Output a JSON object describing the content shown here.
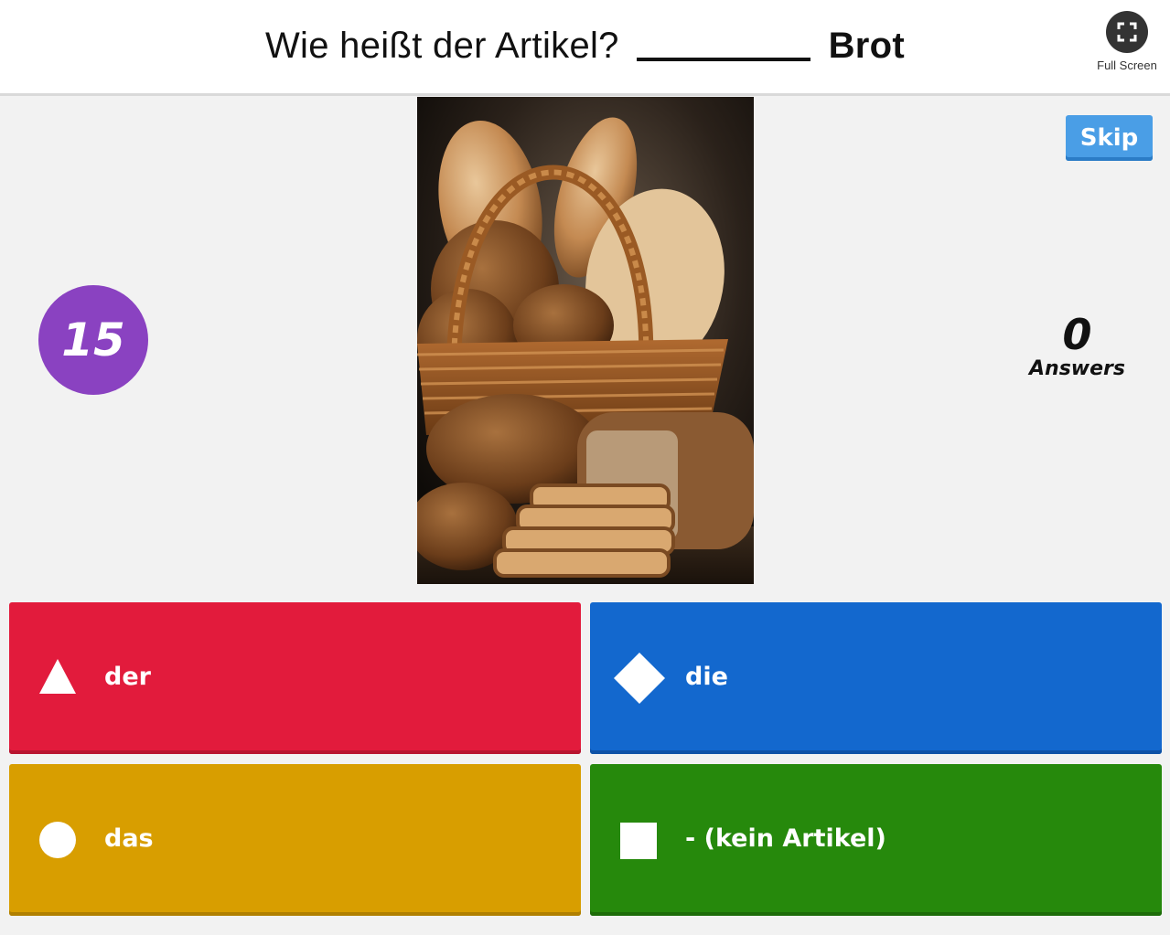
{
  "header": {
    "question": "Wie heißt der Artikel?",
    "word": "Brot",
    "fullscreen_label": "Full Screen"
  },
  "controls": {
    "skip_label": "Skip"
  },
  "timer": {
    "seconds": "15"
  },
  "answers_counter": {
    "count": "0",
    "label": "Answers"
  },
  "image": {
    "icon": "bread-basket-photo"
  },
  "choices": [
    {
      "label": "der",
      "shape": "triangle-icon",
      "color": "#e21b3c"
    },
    {
      "label": "die",
      "shape": "diamond-icon",
      "color": "#1368ce"
    },
    {
      "label": "das",
      "shape": "circle-icon",
      "color": "#d89e00"
    },
    {
      "label": "- (kein Artikel)",
      "shape": "square-icon",
      "color": "#26890c"
    }
  ]
}
